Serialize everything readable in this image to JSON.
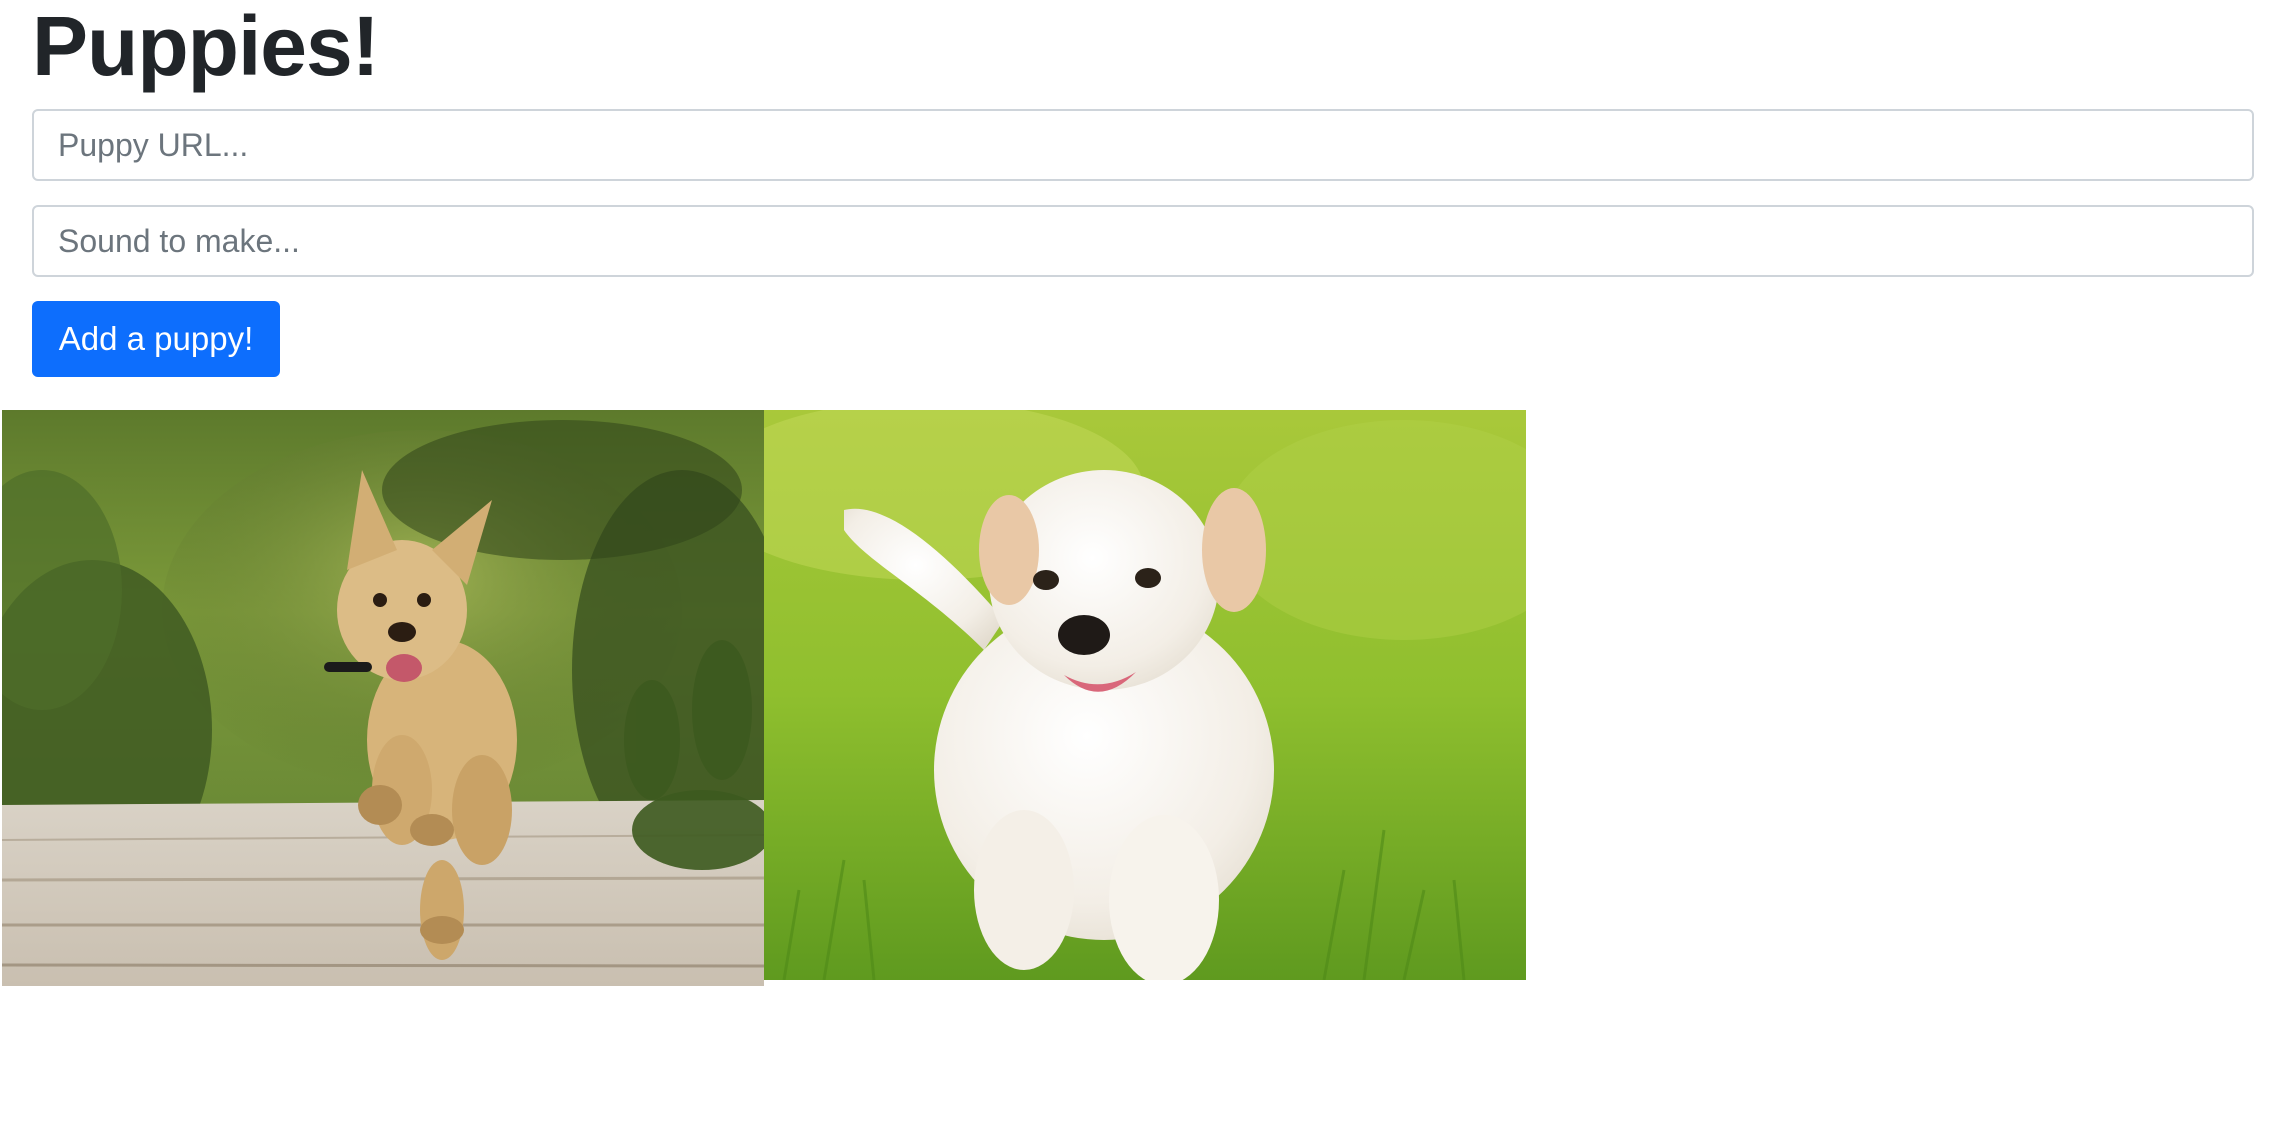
{
  "header": {
    "title": "Puppies!"
  },
  "form": {
    "url_placeholder": "Puppy URL...",
    "url_value": "",
    "sound_placeholder": "Sound to make...",
    "sound_value": "",
    "submit_label": "Add a puppy!"
  },
  "colors": {
    "primary": "#0d6efd",
    "text": "#212529",
    "border": "#ced4da"
  },
  "puppies": [
    {
      "depiction": "fluffy tan terrier puppy running on a wooden boardwalk"
    },
    {
      "depiction": "white fluffy puppy walking on green grass"
    }
  ]
}
